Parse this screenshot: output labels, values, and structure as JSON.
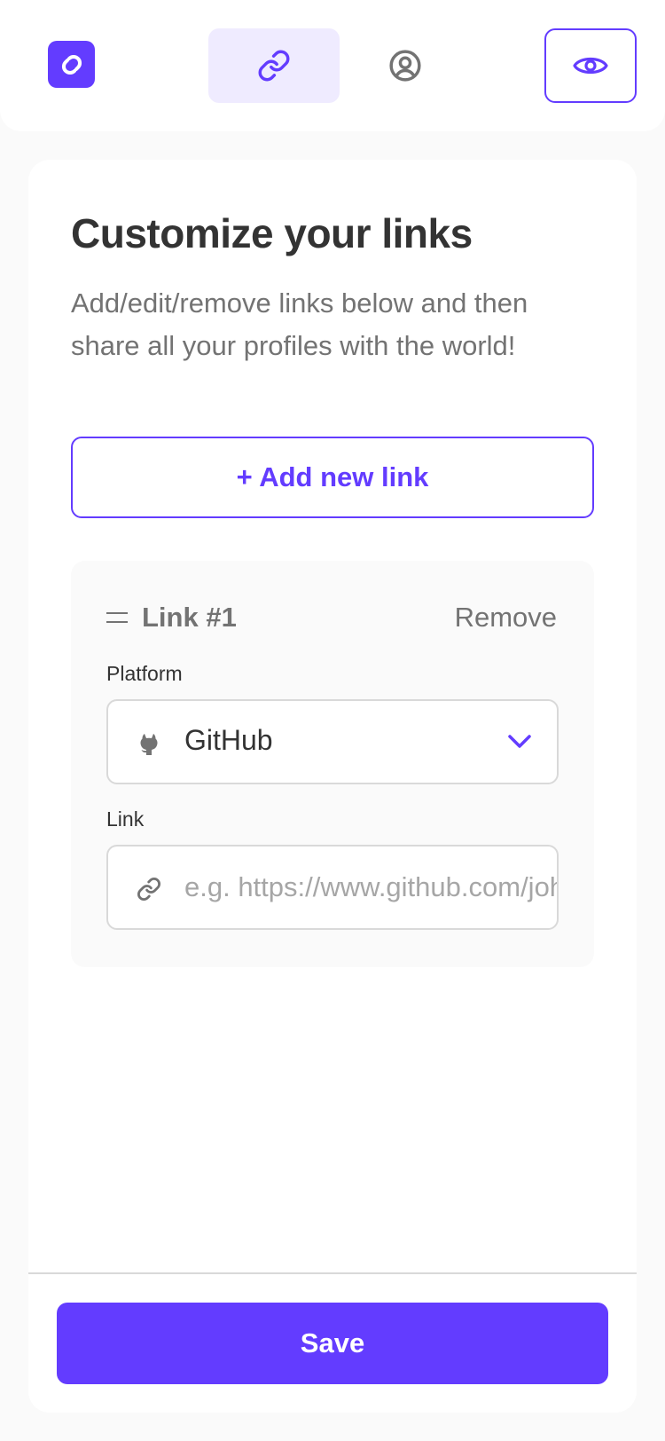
{
  "header": {
    "logo_icon": "link-logo-icon",
    "tabs": [
      {
        "icon": "link-icon",
        "active": true
      },
      {
        "icon": "user-circle-icon",
        "active": false
      }
    ],
    "preview_icon": "eye-icon"
  },
  "main": {
    "title": "Customize your links",
    "subtitle": "Add/edit/remove links below and then share all your profiles with the world!",
    "add_button_label": "+ Add new link",
    "links": [
      {
        "heading": "Link #1",
        "remove_label": "Remove",
        "platform_label": "Platform",
        "platform_value": "GitHub",
        "platform_icon": "github-icon",
        "link_label": "Link",
        "link_placeholder": "e.g. https://www.github.com/johnappleseed",
        "link_value": ""
      }
    ]
  },
  "footer": {
    "save_label": "Save"
  },
  "colors": {
    "accent": "#633CFF",
    "accent_light": "#EFEBFF",
    "text_dark": "#333333",
    "text_muted": "#737373",
    "border": "#D9D9D9"
  }
}
